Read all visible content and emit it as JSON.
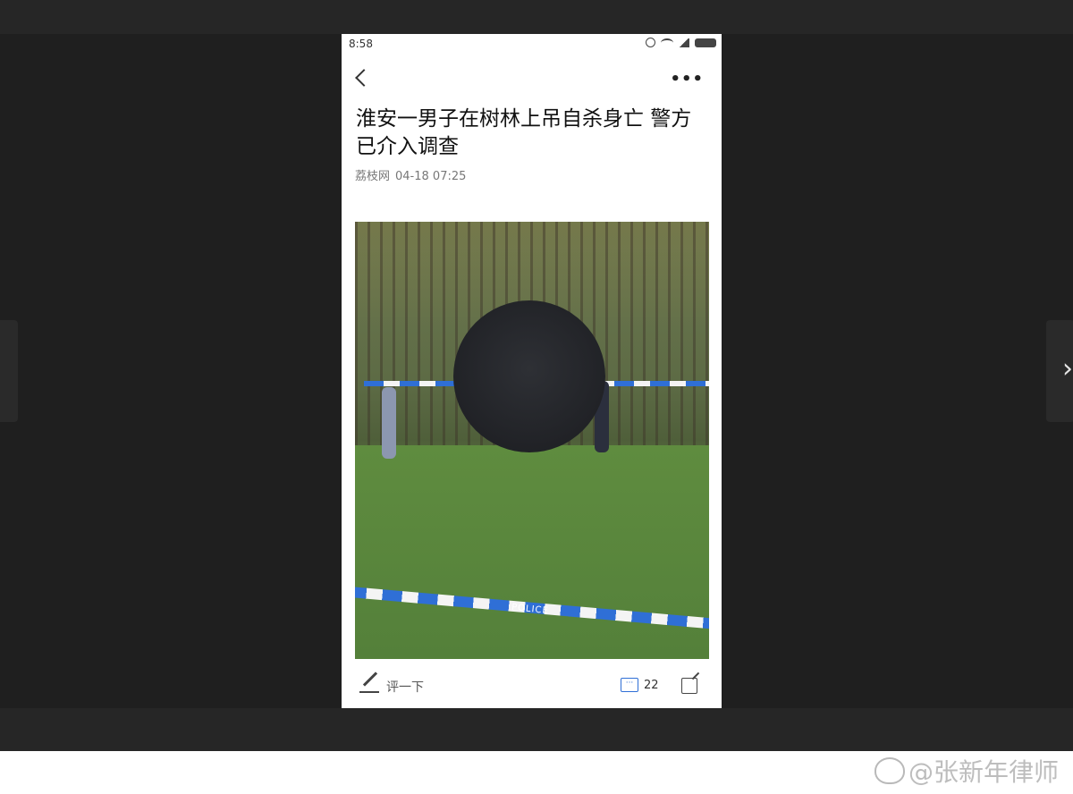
{
  "status_bar": {
    "time": "8:58"
  },
  "article": {
    "title": "淮安一男子在树林上吊自杀身亡 警方已介入调查",
    "source": "荔枝网",
    "date": "04-18 07:25",
    "image": {
      "tape_label": "POLICE"
    }
  },
  "bottom_bar": {
    "comment_placeholder": "评一下",
    "comment_count": "22"
  },
  "watermark": {
    "text": "@张新年律师"
  },
  "colors": {
    "accent": "#2f6fd6",
    "viewer_bg": "#1f1f1f"
  }
}
